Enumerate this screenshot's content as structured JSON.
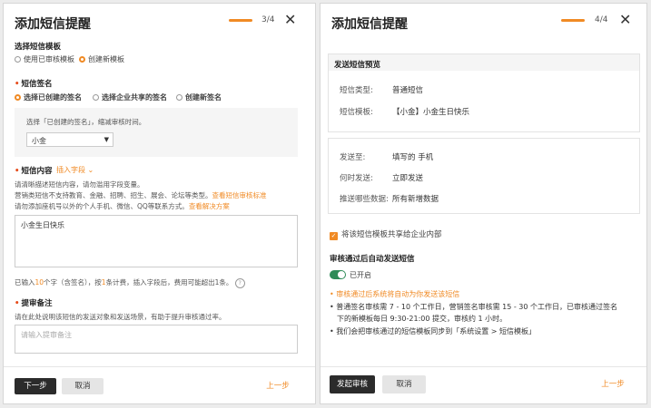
{
  "left": {
    "title": "添加短信提醒",
    "step": "3/4",
    "template_label": "选择短信模板",
    "template_options": [
      "使用已审核模板",
      "创建新模板"
    ],
    "signature_label": "短信签名",
    "signature_options": [
      "选择已创建的签名",
      "选择企业共享的签名",
      "创建新签名"
    ],
    "signature_hint": "选择「已创建的签名」，缩减审核时间。",
    "signature_value": "小金",
    "content_label": "短信内容",
    "insert_field": "插入字段",
    "content_desc_1": "请清晰描述短信内容，请勿滥用字段变量。",
    "content_desc_2": "营销类短信不支持教育、金融、招聘、招生、展会、论坛等类型。",
    "content_desc_2_link": "查看短信审核标准",
    "content_desc_3": "请勿添加座机号以外的个人手机、微信、QQ等联系方式。",
    "content_desc_3_link": "查看解决方案",
    "content_value": "小金生日快乐",
    "count_pre": "已输入",
    "count_num": "10",
    "count_mid": "个字（含签名），按",
    "count_num2": "1",
    "count_post": "条计费，插入字段后，费用可能超出1条。",
    "remark_label": "提审备注",
    "remark_desc": "请在此处说明该短信的发送对象和发送场景，有助于提升审核通过率。",
    "remark_placeholder": "请输入提审备注",
    "next_btn": "下一步",
    "cancel_btn": "取消",
    "prev_btn": "上一步"
  },
  "right": {
    "title": "添加短信提醒",
    "step": "4/4",
    "preview_heading": "发送短信预览",
    "type_label": "短信类型:",
    "type_value": "普通短信",
    "template_label": "短信模板:",
    "template_value": "【小金】小金生日快乐",
    "to_label": "发送至:",
    "to_value": "填写的 手机",
    "when_label": "何时发送:",
    "when_value": "立即发送",
    "which_label": "推送哪些数据:",
    "which_value": "所有新增数据",
    "share_label": "将该短信模板共享给企业内部",
    "auto_heading": "审核通过后自动发送短信",
    "toggle_label": "已开启",
    "bullet_1": "审核通过后系统将自动为你发送该短信",
    "bullet_2a": "普通签名审核需 7 - 10 个工作日，营销签名审核需 15 - 30 个工作日，已审核通过签名",
    "bullet_2b": "下的新模板每日 9:30-21:00 提交，审核约 1 小时。",
    "bullet_3": "我们会把审核通过的短信模板同步到「系统设置 > 短信模板」",
    "submit_btn": "发起审核",
    "cancel_btn": "取消",
    "prev_btn": "上一步"
  },
  "colors": {
    "accent": "#f08a24",
    "dark_button": "#2b2b2b",
    "toggle_on": "#2e8b57"
  }
}
